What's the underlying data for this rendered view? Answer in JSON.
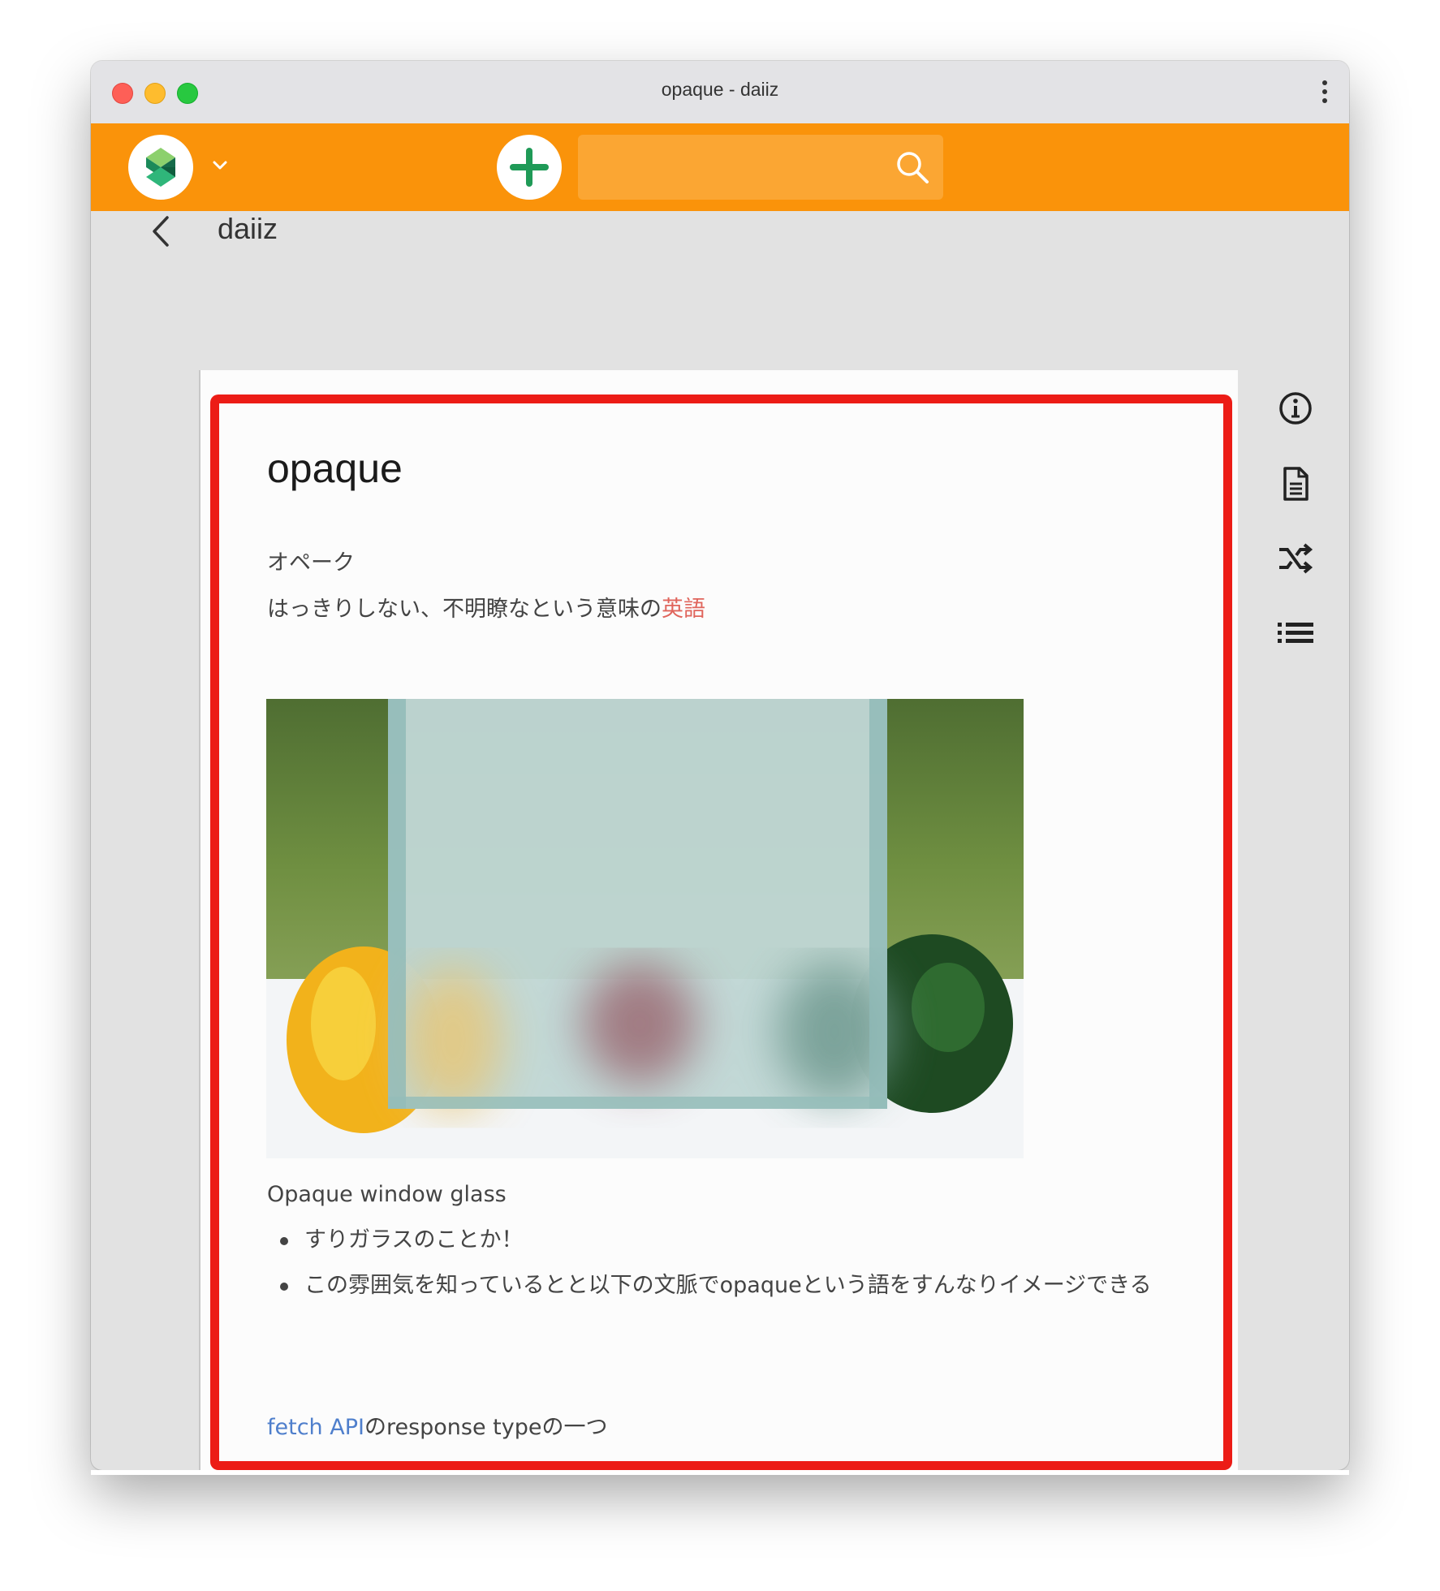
{
  "window": {
    "title": "opaque - daiiz"
  },
  "appbar": {
    "logo_icon": "scrapbox-logo-icon",
    "add_icon": "plus-icon",
    "search": {
      "value": "",
      "placeholder": "",
      "icon": "search-icon"
    },
    "accent_color": "#fa930a"
  },
  "breadcrumb": {
    "back_icon": "chevron-left-icon",
    "project_name": "daiiz"
  },
  "page": {
    "title": "opaque",
    "reading": "オペーク",
    "meaning_prefix": "はっきりしない、不明瞭なという意味の",
    "meaning_link": "英語",
    "image_caption": "Opaque window glass",
    "bullets": [
      "すりガラスのことか！",
      "この雰囲気を知っているとと以下の文脈でopaqueという語をすんなりイメージできる"
    ],
    "fetch_link": "fetch API",
    "fetch_suffix": "のresponse typeの一つ",
    "link_red": "#e0655c",
    "link_blue": "#4f7fcc"
  },
  "side_toolbar": {
    "icons": [
      "info-icon",
      "document-icon",
      "shuffle-icon",
      "list-icon"
    ]
  },
  "highlight_color": "#ec1c16"
}
